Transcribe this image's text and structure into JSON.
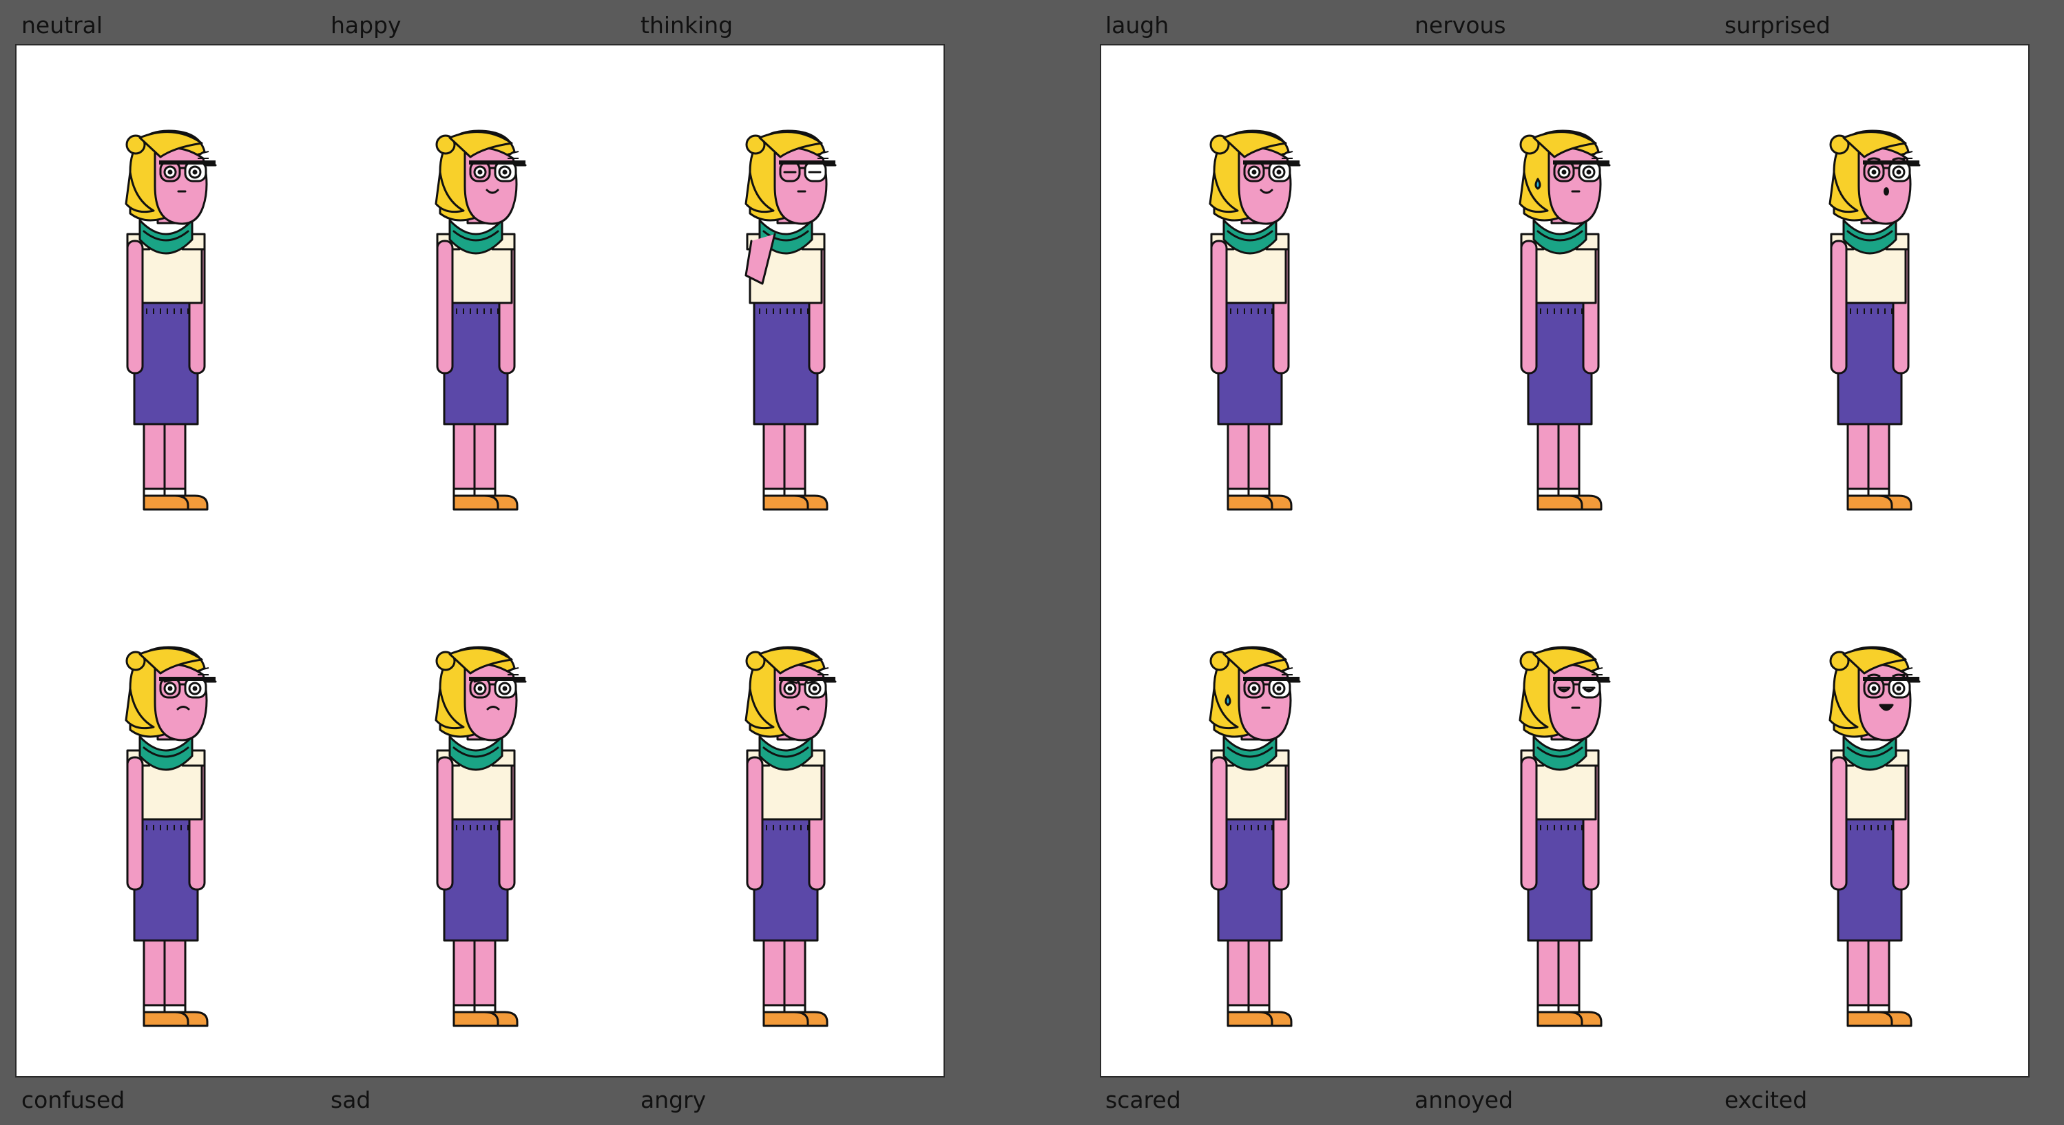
{
  "sheets": [
    {
      "top_labels": [
        "neutral",
        "happy",
        "thinking"
      ],
      "bottom_labels": [
        "confused",
        "sad",
        "angry"
      ]
    },
    {
      "top_labels": [
        "laugh",
        "nervous",
        "surprised"
      ],
      "bottom_labels": [
        "scared",
        "annoyed",
        "excited"
      ]
    }
  ],
  "colors": {
    "background": "#5b5b5b",
    "panel": "#ffffff",
    "skin": "#f29bc4",
    "hair": "#f8d02a",
    "scarf": "#1aa486",
    "shirt": "#fcf4dd",
    "skirt": "#5b48a8",
    "shoe": "#f39b3a",
    "outline": "#111111",
    "tear": "#2bb7d8"
  },
  "expressions": {
    "row1": [
      "neutral",
      "happy",
      "thinking"
    ],
    "row2": [
      "confused",
      "sad",
      "angry"
    ],
    "row3": [
      "laugh",
      "nervous",
      "surprised"
    ],
    "row4": [
      "scared",
      "annoyed",
      "excited"
    ]
  }
}
